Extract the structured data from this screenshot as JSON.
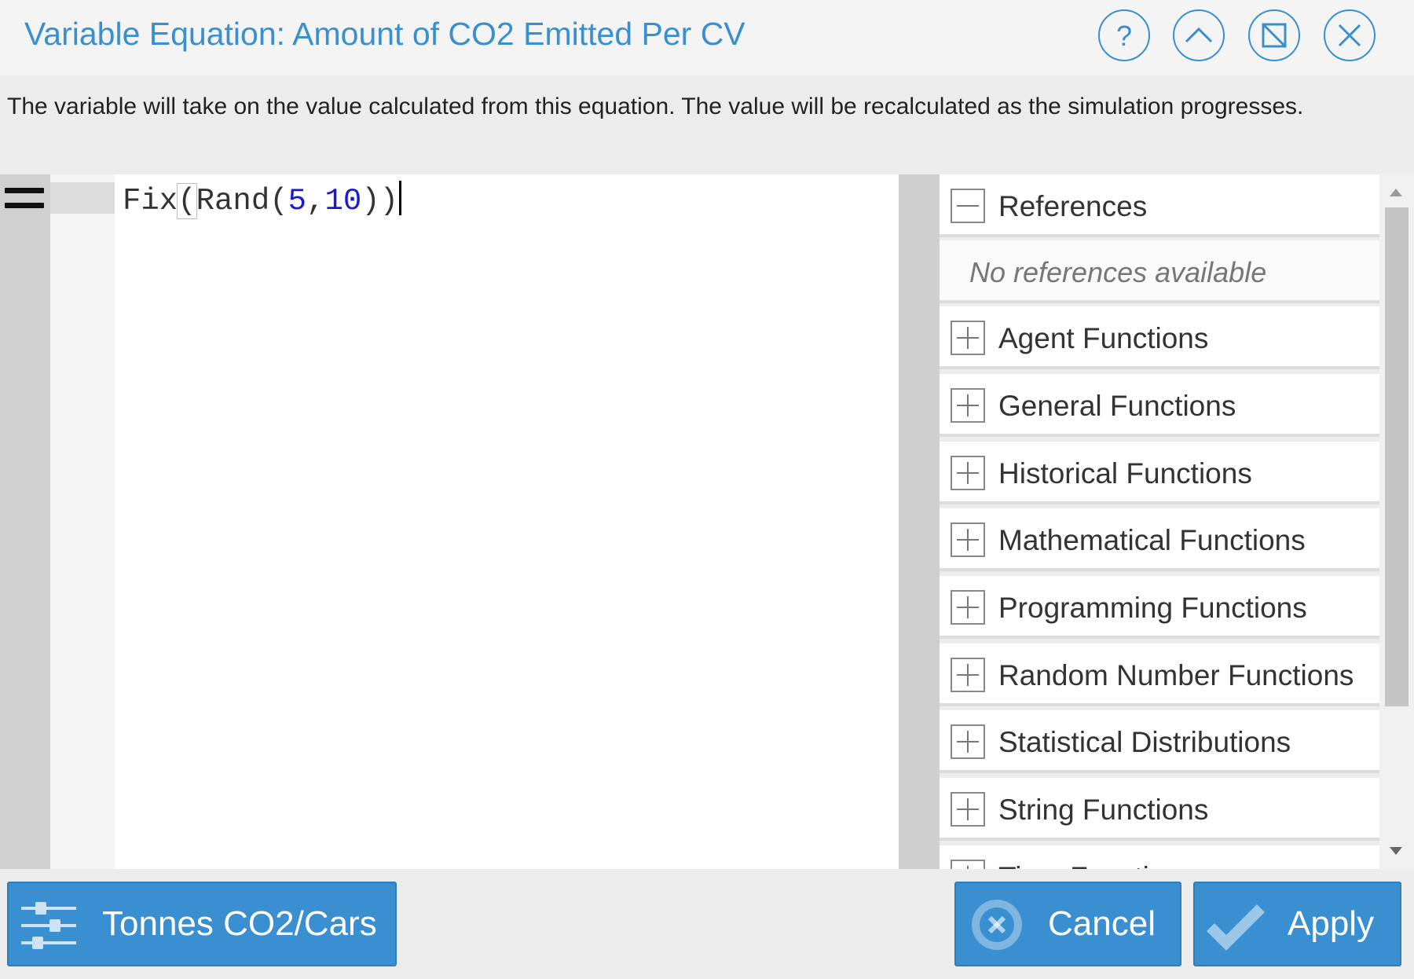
{
  "dialog": {
    "title": "Variable Equation: Amount of CO2 Emitted Per CV",
    "description": "The variable will take on the value calculated from this equation. The value will be recalculated as the simulation progresses."
  },
  "titlebar_buttons": [
    {
      "icon": "help-icon"
    },
    {
      "icon": "chevron-up-icon"
    },
    {
      "icon": "maximize-icon"
    },
    {
      "icon": "close-icon"
    }
  ],
  "editor": {
    "code": {
      "fn_outer": "Fix",
      "open_outer": "(",
      "fn_inner": "Rand",
      "open_inner": "(",
      "arg1": "5",
      "comma": ",",
      "arg2": "10",
      "close": "))"
    }
  },
  "side_panel": {
    "references_label": "References",
    "references_empty": "No references available",
    "categories": [
      "Agent Functions",
      "General Functions",
      "Historical Functions",
      "Mathematical Functions",
      "Programming Functions",
      "Random Number Functions",
      "Statistical Distributions",
      "String Functions",
      "Time Functions"
    ]
  },
  "footer": {
    "units_label": "Tonnes CO2/Cars",
    "cancel_label": "Cancel",
    "apply_label": "Apply"
  },
  "colors": {
    "accent": "#3a8fd0",
    "number_token": "#1a1acc"
  }
}
